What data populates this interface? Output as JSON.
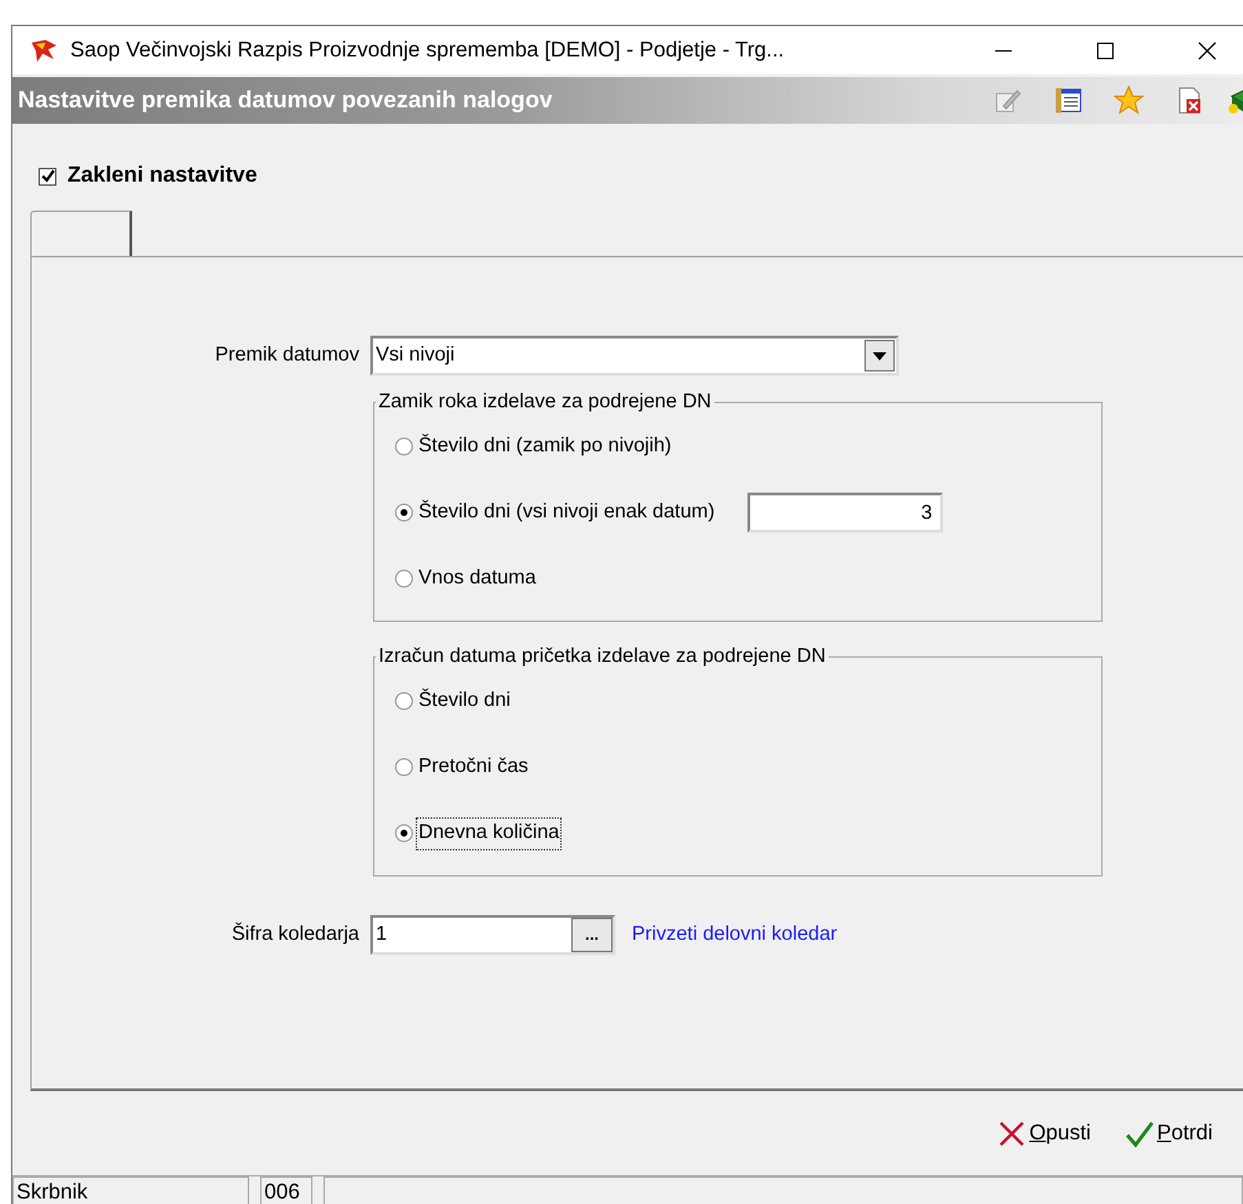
{
  "window": {
    "title": "Saop  Večinvojski Razpis Proizvodnje sprememba [DEMO] - Podjetje - Trg..."
  },
  "header": {
    "title": "Nastavitve premika datumov povezanih nalogov"
  },
  "lock_settings": {
    "label": "Zakleni nastavitve",
    "checked": true
  },
  "form": {
    "shift": {
      "label": "Premik datumov",
      "value": "Vsi nivoji"
    },
    "groups": [
      {
        "title": "Zamik roka izdelave za podrejene DN",
        "options": [
          {
            "label": "Število dni (zamik po nivojih)",
            "selected": false
          },
          {
            "label": "Število dni (vsi nivoji enak datum)",
            "selected": true,
            "value": "3"
          },
          {
            "label": "Vnos datuma",
            "selected": false
          }
        ]
      },
      {
        "title": "Izračun datuma pričetka izdelave za podrejene DN",
        "options": [
          {
            "label": "Število dni",
            "selected": false
          },
          {
            "label": "Pretočni čas",
            "selected": false
          },
          {
            "label": "Dnevna količina",
            "selected": true,
            "focused": true
          }
        ]
      }
    ],
    "calendar": {
      "label": "Šifra koledarja",
      "value": "1",
      "button": "...",
      "link": "Privzeti delovni koledar"
    }
  },
  "buttons": [
    {
      "label": "Opusti",
      "kind": "cancel"
    },
    {
      "label": "Potrdi",
      "kind": "confirm"
    }
  ],
  "status_bar": [
    "Skrbnik",
    "006"
  ]
}
